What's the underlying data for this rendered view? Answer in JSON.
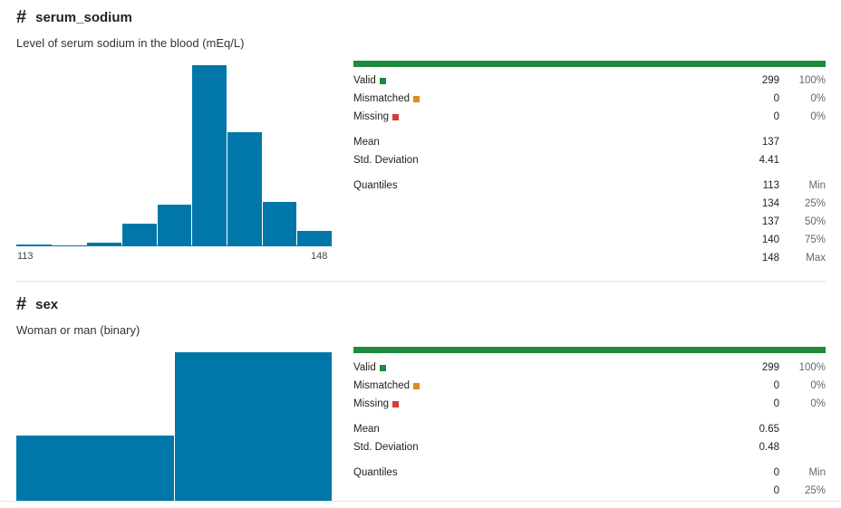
{
  "columns": [
    {
      "name": "serum_sodium",
      "description": "Level of serum sodium in the blood (mEq/L)",
      "histogram": {
        "axis_min_label": "113",
        "axis_max_label": "148",
        "bins": [
          0.012,
          0.005,
          0.02,
          0.125,
          0.23,
          1.0,
          0.63,
          0.245,
          0.085
        ]
      },
      "stats": {
        "valid": {
          "label": "Valid",
          "value": "299",
          "pct": "100%"
        },
        "mismatched": {
          "label": "Mismatched",
          "value": "0",
          "pct": "0%"
        },
        "missing": {
          "label": "Missing",
          "value": "0",
          "pct": "0%"
        },
        "mean": {
          "label": "Mean",
          "value": "137"
        },
        "std": {
          "label": "Std. Deviation",
          "value": "4.41"
        },
        "quantiles_label": "Quantiles",
        "quantiles": [
          {
            "value": "113",
            "label": "Min"
          },
          {
            "value": "134",
            "label": "25%"
          },
          {
            "value": "137",
            "label": "50%"
          },
          {
            "value": "140",
            "label": "75%"
          },
          {
            "value": "148",
            "label": "Max"
          }
        ]
      }
    },
    {
      "name": "sex",
      "description": "Woman or man (binary)",
      "histogram": {
        "bins": [
          0.44,
          1.0
        ]
      },
      "stats": {
        "valid": {
          "label": "Valid",
          "value": "299",
          "pct": "100%"
        },
        "mismatched": {
          "label": "Mismatched",
          "value": "0",
          "pct": "0%"
        },
        "missing": {
          "label": "Missing",
          "value": "0",
          "pct": "0%"
        },
        "mean": {
          "label": "Mean",
          "value": "0.65"
        },
        "std": {
          "label": "Std. Deviation",
          "value": "0.48"
        },
        "quantiles_label": "Quantiles",
        "quantiles": [
          {
            "value": "0",
            "label": "Min"
          },
          {
            "value": "0",
            "label": "25%"
          }
        ]
      }
    }
  ],
  "colors": {
    "valid": "#1e8a3a",
    "mismatched": "#e08a1e",
    "missing": "#d83a3a",
    "histogram": "#0077a8"
  },
  "icons": {
    "column_type": "hash-icon"
  }
}
